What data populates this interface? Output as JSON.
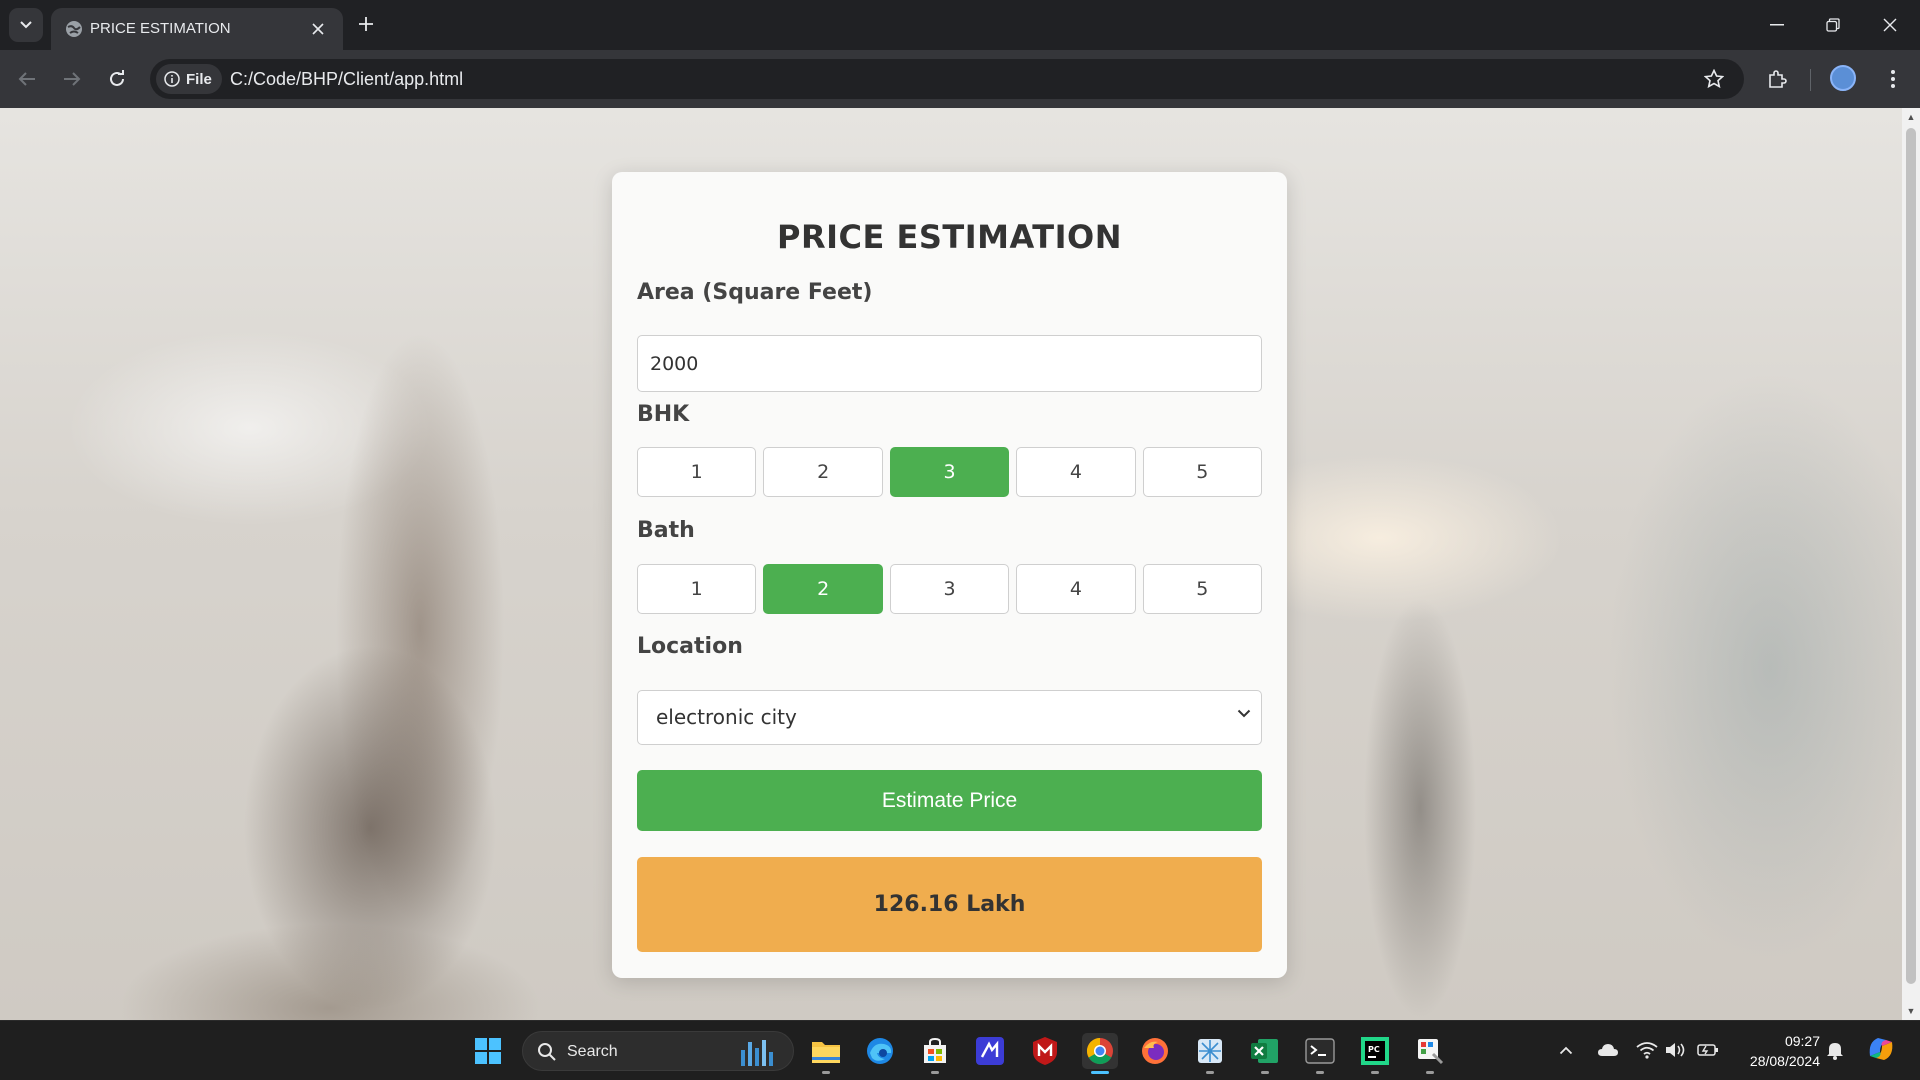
{
  "browser": {
    "tab_title": "PRICE ESTIMATION",
    "site_chip_label": "File",
    "url": "C:/Code/BHP/Client/app.html"
  },
  "form": {
    "title": "PRICE ESTIMATION",
    "area_label": "Area (Square Feet)",
    "area_value": "2000",
    "bhk_label": "BHK",
    "bhk_options": [
      "1",
      "2",
      "3",
      "4",
      "5"
    ],
    "bhk_selected": "3",
    "bath_label": "Bath",
    "bath_options": [
      "1",
      "2",
      "3",
      "4",
      "5"
    ],
    "bath_selected": "2",
    "location_label": "Location",
    "location_value": "electronic city",
    "estimate_button": "Estimate Price",
    "result": "126.16 Lakh"
  },
  "colors": {
    "accent_green": "#4caf50",
    "result_orange": "#f0ad4e"
  },
  "taskbar": {
    "search_label": "Search",
    "apps": [
      "file-explorer-icon",
      "edge-icon",
      "store-icon",
      "visual-studio-icon",
      "mcafee-icon",
      "chrome-icon",
      "firefox-icon",
      "snipping-icon",
      "excel-icon",
      "terminal-icon",
      "pycharm-icon",
      "paint-icon"
    ],
    "time": "09:27",
    "date": "28/08/2024"
  }
}
